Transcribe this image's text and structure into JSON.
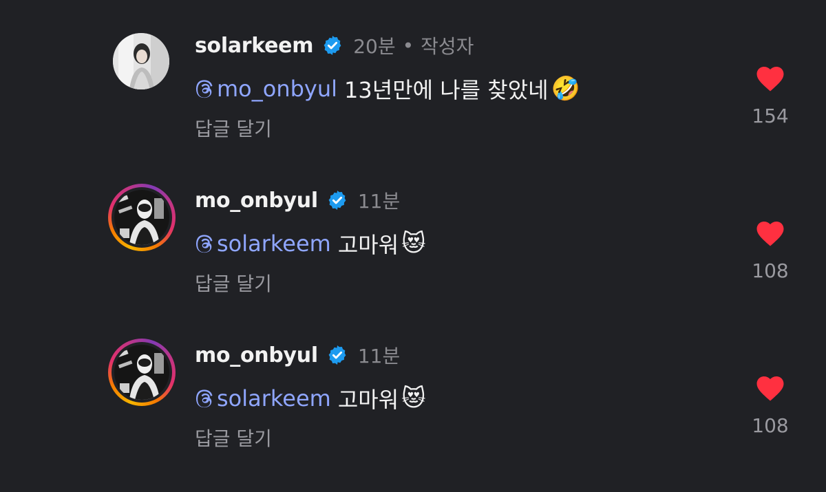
{
  "comments": [
    {
      "username": "solarkeem",
      "time": "20분",
      "role": "작성자",
      "mention": "mo_onbyul",
      "text": "13년만에 나를 찾았네",
      "emoji": "🤣",
      "reply_label": "답글 달기",
      "likes": "154"
    },
    {
      "username": "mo_onbyul",
      "time": "11분",
      "mention": "solarkeem",
      "text": "고마워",
      "emoji": "😻",
      "reply_label": "답글 달기",
      "likes": "108"
    },
    {
      "username": "mo_onbyul",
      "time": "11분",
      "mention": "solarkeem",
      "text": "고마워",
      "emoji": "😻",
      "reply_label": "답글 달기",
      "likes": "108"
    }
  ],
  "colors": {
    "background": "#202125",
    "mention": "#8fa6ff",
    "verified": "#1d9bf0",
    "heart": "#ff3040",
    "muted": "#8b8b90"
  },
  "icons": {
    "verified": "verified-badge-icon",
    "mention": "threads-at-icon",
    "like": "heart-icon"
  }
}
